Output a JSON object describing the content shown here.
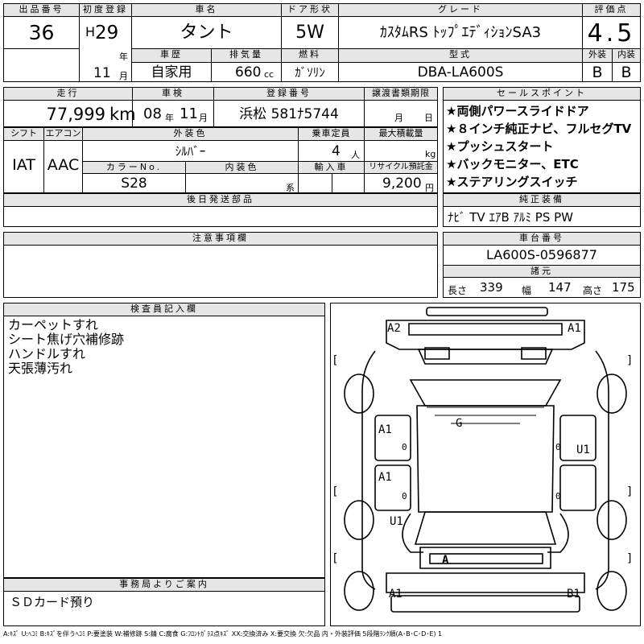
{
  "header": {
    "lot_label": "出品番号",
    "lot_number": "36",
    "first_reg_label": "初度登録",
    "era": "H",
    "year": "29",
    "year_suffix": "年",
    "month": "11",
    "month_suffix": "月",
    "car_name_label": "車名",
    "car_name": "タント",
    "door_label": "ドア形状",
    "door": "5W",
    "grade_label": "グレード",
    "grade": "ｶｽﾀﾑRS ﾄｯﾌﾟｴﾃﾞｨｼｮﾝSA3",
    "score_label": "評価点",
    "score": "4.5",
    "history_label": "車歴",
    "history": "自家用",
    "displacement_label": "排気量",
    "displacement": "660",
    "displacement_unit": "cc",
    "fuel_label": "燃料",
    "fuel": "ｶﾞｿﾘﾝ",
    "model_label": "型式",
    "model": "DBA-LA600S",
    "exterior_label": "外装",
    "exterior": "B",
    "interior_label": "内装",
    "interior": "B"
  },
  "row2": {
    "mileage_label": "走行",
    "mileage": "77,999",
    "mileage_unit": "km",
    "inspection_label": "車検",
    "inspection_year": "08",
    "inspection_year_suffix": "年",
    "inspection_month": "11",
    "inspection_month_suffix": "月",
    "plate_label": "登録番号",
    "plate": "浜松 581ﾅ5744",
    "transfer_label": "譲渡書類期限",
    "transfer_month": "月",
    "transfer_day": "日"
  },
  "row3": {
    "shift_label": "シフト",
    "shift": "IAT",
    "ac_label": "エアコン",
    "ac": "AAC",
    "ext_color_label": "外装色",
    "ext_color": "ｼﾙﾊﾞｰ",
    "capacity_label": "乗車定員",
    "capacity": "4",
    "capacity_unit": "人",
    "load_label": "最大積載量",
    "load_unit": "kg",
    "color_no_label": "カラーNo.",
    "color_no": "S28",
    "int_color_label": "内装色",
    "int_color_suffix": "系",
    "import_label": "輸入車",
    "recycle_label": "リサイクル預託金",
    "recycle": "9,200",
    "recycle_unit": "円"
  },
  "later_parts": {
    "label": "後日発送部品",
    "value": ""
  },
  "cautions": {
    "label": "注意事項欄",
    "value": ""
  },
  "sales_points": {
    "label": "セールスポイント",
    "items": [
      "★両側パワースライドドア",
      "★８インチ純正ナビ、フルセグTV",
      "★プッシュスタート",
      "★バックモニター、ETC",
      "★ステアリングスイッチ"
    ]
  },
  "equipment": {
    "label": "純正装備",
    "value": "ﾅﾋﾞ TV ｴｱB ｱﾙﾐ PS PW"
  },
  "chassis": {
    "label": "車台番号",
    "value": "LA600S-0596877",
    "spec_label": "諸元",
    "length_label": "長さ",
    "length": "339",
    "width_label": "幅",
    "width": "147",
    "height_label": "高さ",
    "height": "175"
  },
  "inspector": {
    "label": "検査員記入欄",
    "notes": [
      "カーペットすれ",
      "シート焦げ穴補修跡",
      "ハンドルすれ",
      "天張薄汚れ"
    ]
  },
  "office": {
    "label": "事務局よりご案内",
    "value": "ＳＤカード預り"
  },
  "diagram": {
    "marks": {
      "front_left": "A2",
      "front_right": "A1",
      "left_front_door": "A1",
      "left_rear_door": "A1",
      "left_rear_fender": "U1",
      "right_rear_door": "U1",
      "glass": "G",
      "rear_panel": "A",
      "rear_bumper_left": "A1",
      "rear_bumper_right": "B1",
      "door_small_1": "0",
      "door_small_2": "0",
      "door_small_3": "0",
      "door_small_4": "0"
    },
    "bracket_labels": [
      "[",
      "]",
      "[",
      "]",
      "[",
      "]"
    ]
  },
  "legend": "A:ｷｽﾞ U:ﾍｺﾐ B:ｷｽﾞを伴うﾍｺﾐ P:要塗装 W:補修跡 S:錆 C:腐食 G:ﾌﾛﾝﾄｶﾞﾗｽ点ｷｽﾞ XX:交換済み X:要交換 欠:欠品 内・外装評価 5段階ﾗﾝｸ順(A･B･C･D･E) 1"
}
